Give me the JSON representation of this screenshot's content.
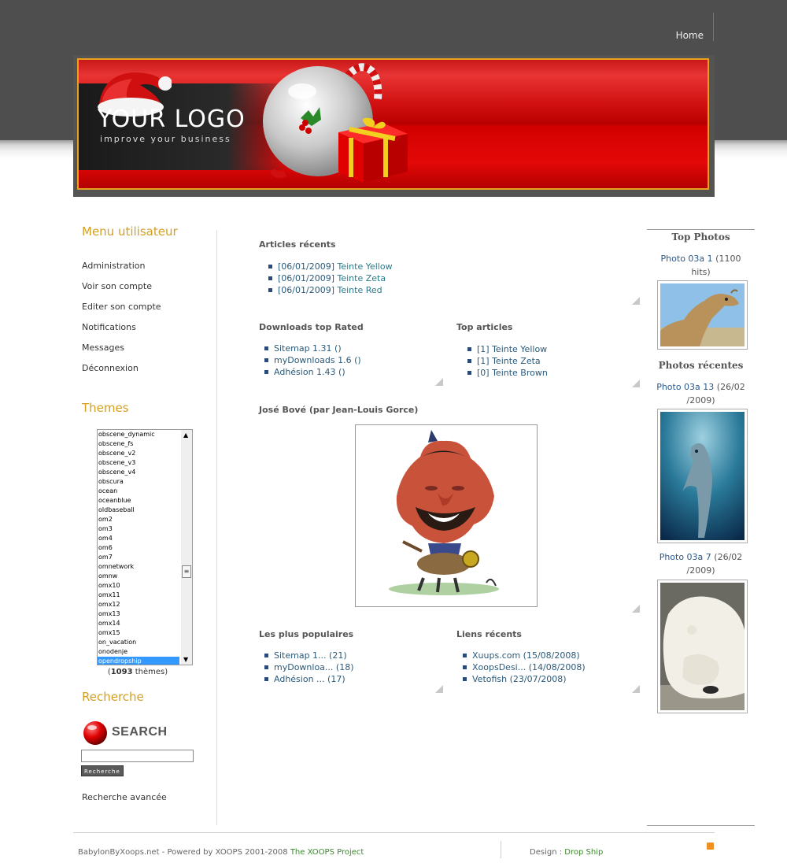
{
  "header": {
    "home_label": "Home"
  },
  "banner": {
    "logo_text": "YOUR LOGO",
    "logo_tagline": "improve your business"
  },
  "left": {
    "user_menu_title": "Menu utilisateur",
    "user_menu": [
      "Administration",
      "Voir son compte",
      "Editer son compte",
      "Notifications",
      "Messages",
      "Déconnexion"
    ],
    "themes_title": "Themes",
    "themes": [
      "obscene_dynamic",
      "obscene_fs",
      "obscene_v2",
      "obscene_v3",
      "obscene_v4",
      "obscura",
      "ocean",
      "oceanblue",
      "oldbaseball",
      "om2",
      "om3",
      "om4",
      "om6",
      "om7",
      "omnetwork",
      "omnw",
      "omx10",
      "omx11",
      "omx12",
      "omx13",
      "omx14",
      "omx15",
      "on_vacation",
      "onodenje",
      "opendropship"
    ],
    "themes_selected": "opendropship",
    "themes_count": "1093",
    "themes_count_suffix": " thèmes)",
    "themes_count_prefix": "(",
    "search_title": "Recherche",
    "search_logo_text": "SEARCH",
    "search_button": "Recherche",
    "advanced_search": "Recherche avancée"
  },
  "center": {
    "recent_articles": {
      "title": "Articles récents",
      "items": [
        {
          "date": "[06/01/2009]",
          "name": "Teinte Yellow"
        },
        {
          "date": "[06/01/2009]",
          "name": "Teinte Zeta"
        },
        {
          "date": "[06/01/2009]",
          "name": "Teinte Red"
        }
      ]
    },
    "downloads_top_rated": {
      "title": "Downloads top Rated",
      "items": [
        "Sitemap 1.31 ()",
        "myDownloads 1.6 ()",
        "Adhésion 1.43 ()"
      ]
    },
    "top_articles": {
      "title": "Top articles",
      "items": [
        "[1] Teinte Yellow",
        "[1] Teinte Zeta",
        "[0] Teinte Brown"
      ]
    },
    "caricature_title": "José Bové (par Jean-Louis Gorce)",
    "most_popular": {
      "title": "Les plus populaires",
      "items": [
        "Sitemap 1... (21)",
        "myDownloa... (18)",
        "Adhésion ... (17)"
      ]
    },
    "recent_links": {
      "title": "Liens récents",
      "items": [
        "Xuups.com (15/08/2008)",
        "XoopsDesi... (14/08/2008)",
        "Vetofish (23/07/2008)"
      ]
    }
  },
  "right": {
    "top_photos_title": "Top Photos",
    "top_photo_caption_link": "Photo 03a 1",
    "top_photo_caption_rest": " (1100 hits)",
    "recent_photos_title": "Photos récentes",
    "recent1_link": "Photo 03a 13",
    "recent1_rest": " (26/02 /2009)",
    "recent2_link": "Photo 03a 7",
    "recent2_rest": " (26/02 /2009)"
  },
  "footer": {
    "left_text": "BabylonByXoops.net - Powered by XOOPS 2001-2008 ",
    "left_link": "The XOOPS Project",
    "right_text": "Design : ",
    "right_link": "Drop Ship"
  },
  "colors": {
    "gold": "#d4a020",
    "link_blue": "#2a5a7a",
    "banner_red": "#d00000",
    "header_gray": "#4e4e4e"
  }
}
